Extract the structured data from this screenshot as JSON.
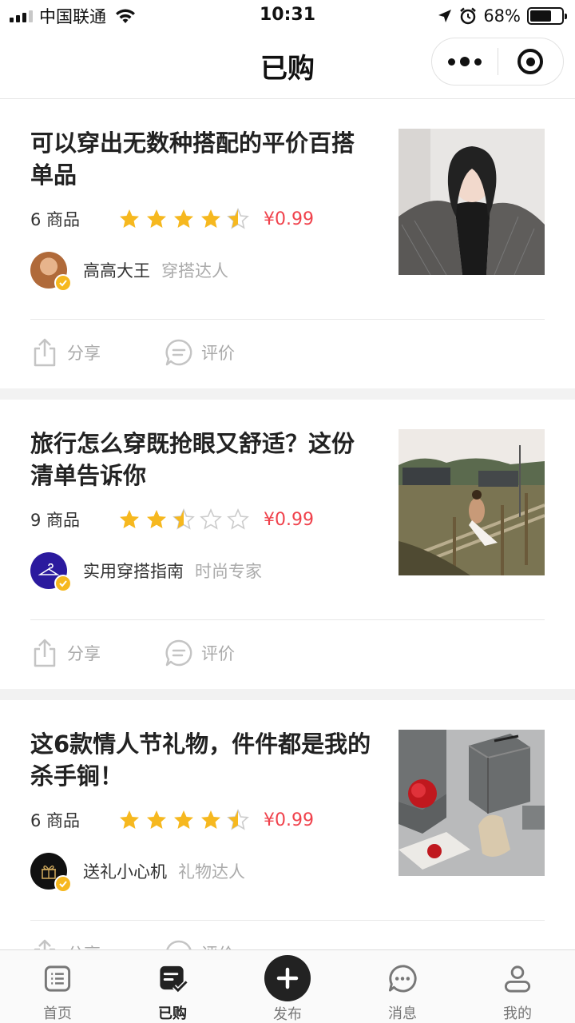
{
  "status_bar": {
    "carrier": "中国联通",
    "time": "10:31",
    "battery_percent": "68%",
    "battery_level": 0.68
  },
  "nav": {
    "title": "已购"
  },
  "cards": [
    {
      "title": "可以穿出无数种搭配的平价百搭单品",
      "count": "6 商品",
      "rating": 4.5,
      "price": "¥0.99",
      "author": "高高大王",
      "author_tag": "穿搭达人",
      "share_label": "分享",
      "review_label": "评价"
    },
    {
      "title": "旅行怎么穿既抢眼又舒适？这份清单告诉你",
      "count": "9 商品",
      "rating": 2.5,
      "price": "¥0.99",
      "author": "实用穿搭指南",
      "author_tag": "时尚专家",
      "share_label": "分享",
      "review_label": "评价"
    },
    {
      "title": "这6款情人节礼物，件件都是我的杀手锏！",
      "count": "6 商品",
      "rating": 4.5,
      "price": "¥0.99",
      "author": "送礼小心机",
      "author_tag": "礼物达人",
      "share_label": "分享",
      "review_label": "评价"
    }
  ],
  "tabs": [
    {
      "label": "首页",
      "icon": "home-list-icon"
    },
    {
      "label": "已购",
      "icon": "purchased-icon"
    },
    {
      "label": "发布",
      "icon": "plus-icon"
    },
    {
      "label": "消息",
      "icon": "chat-icon"
    },
    {
      "label": "我的",
      "icon": "person-icon"
    }
  ],
  "colors": {
    "price": "#f0424c",
    "star": "#f6b81f",
    "star_empty": "#cccccc",
    "badge": "#f6b81f"
  }
}
